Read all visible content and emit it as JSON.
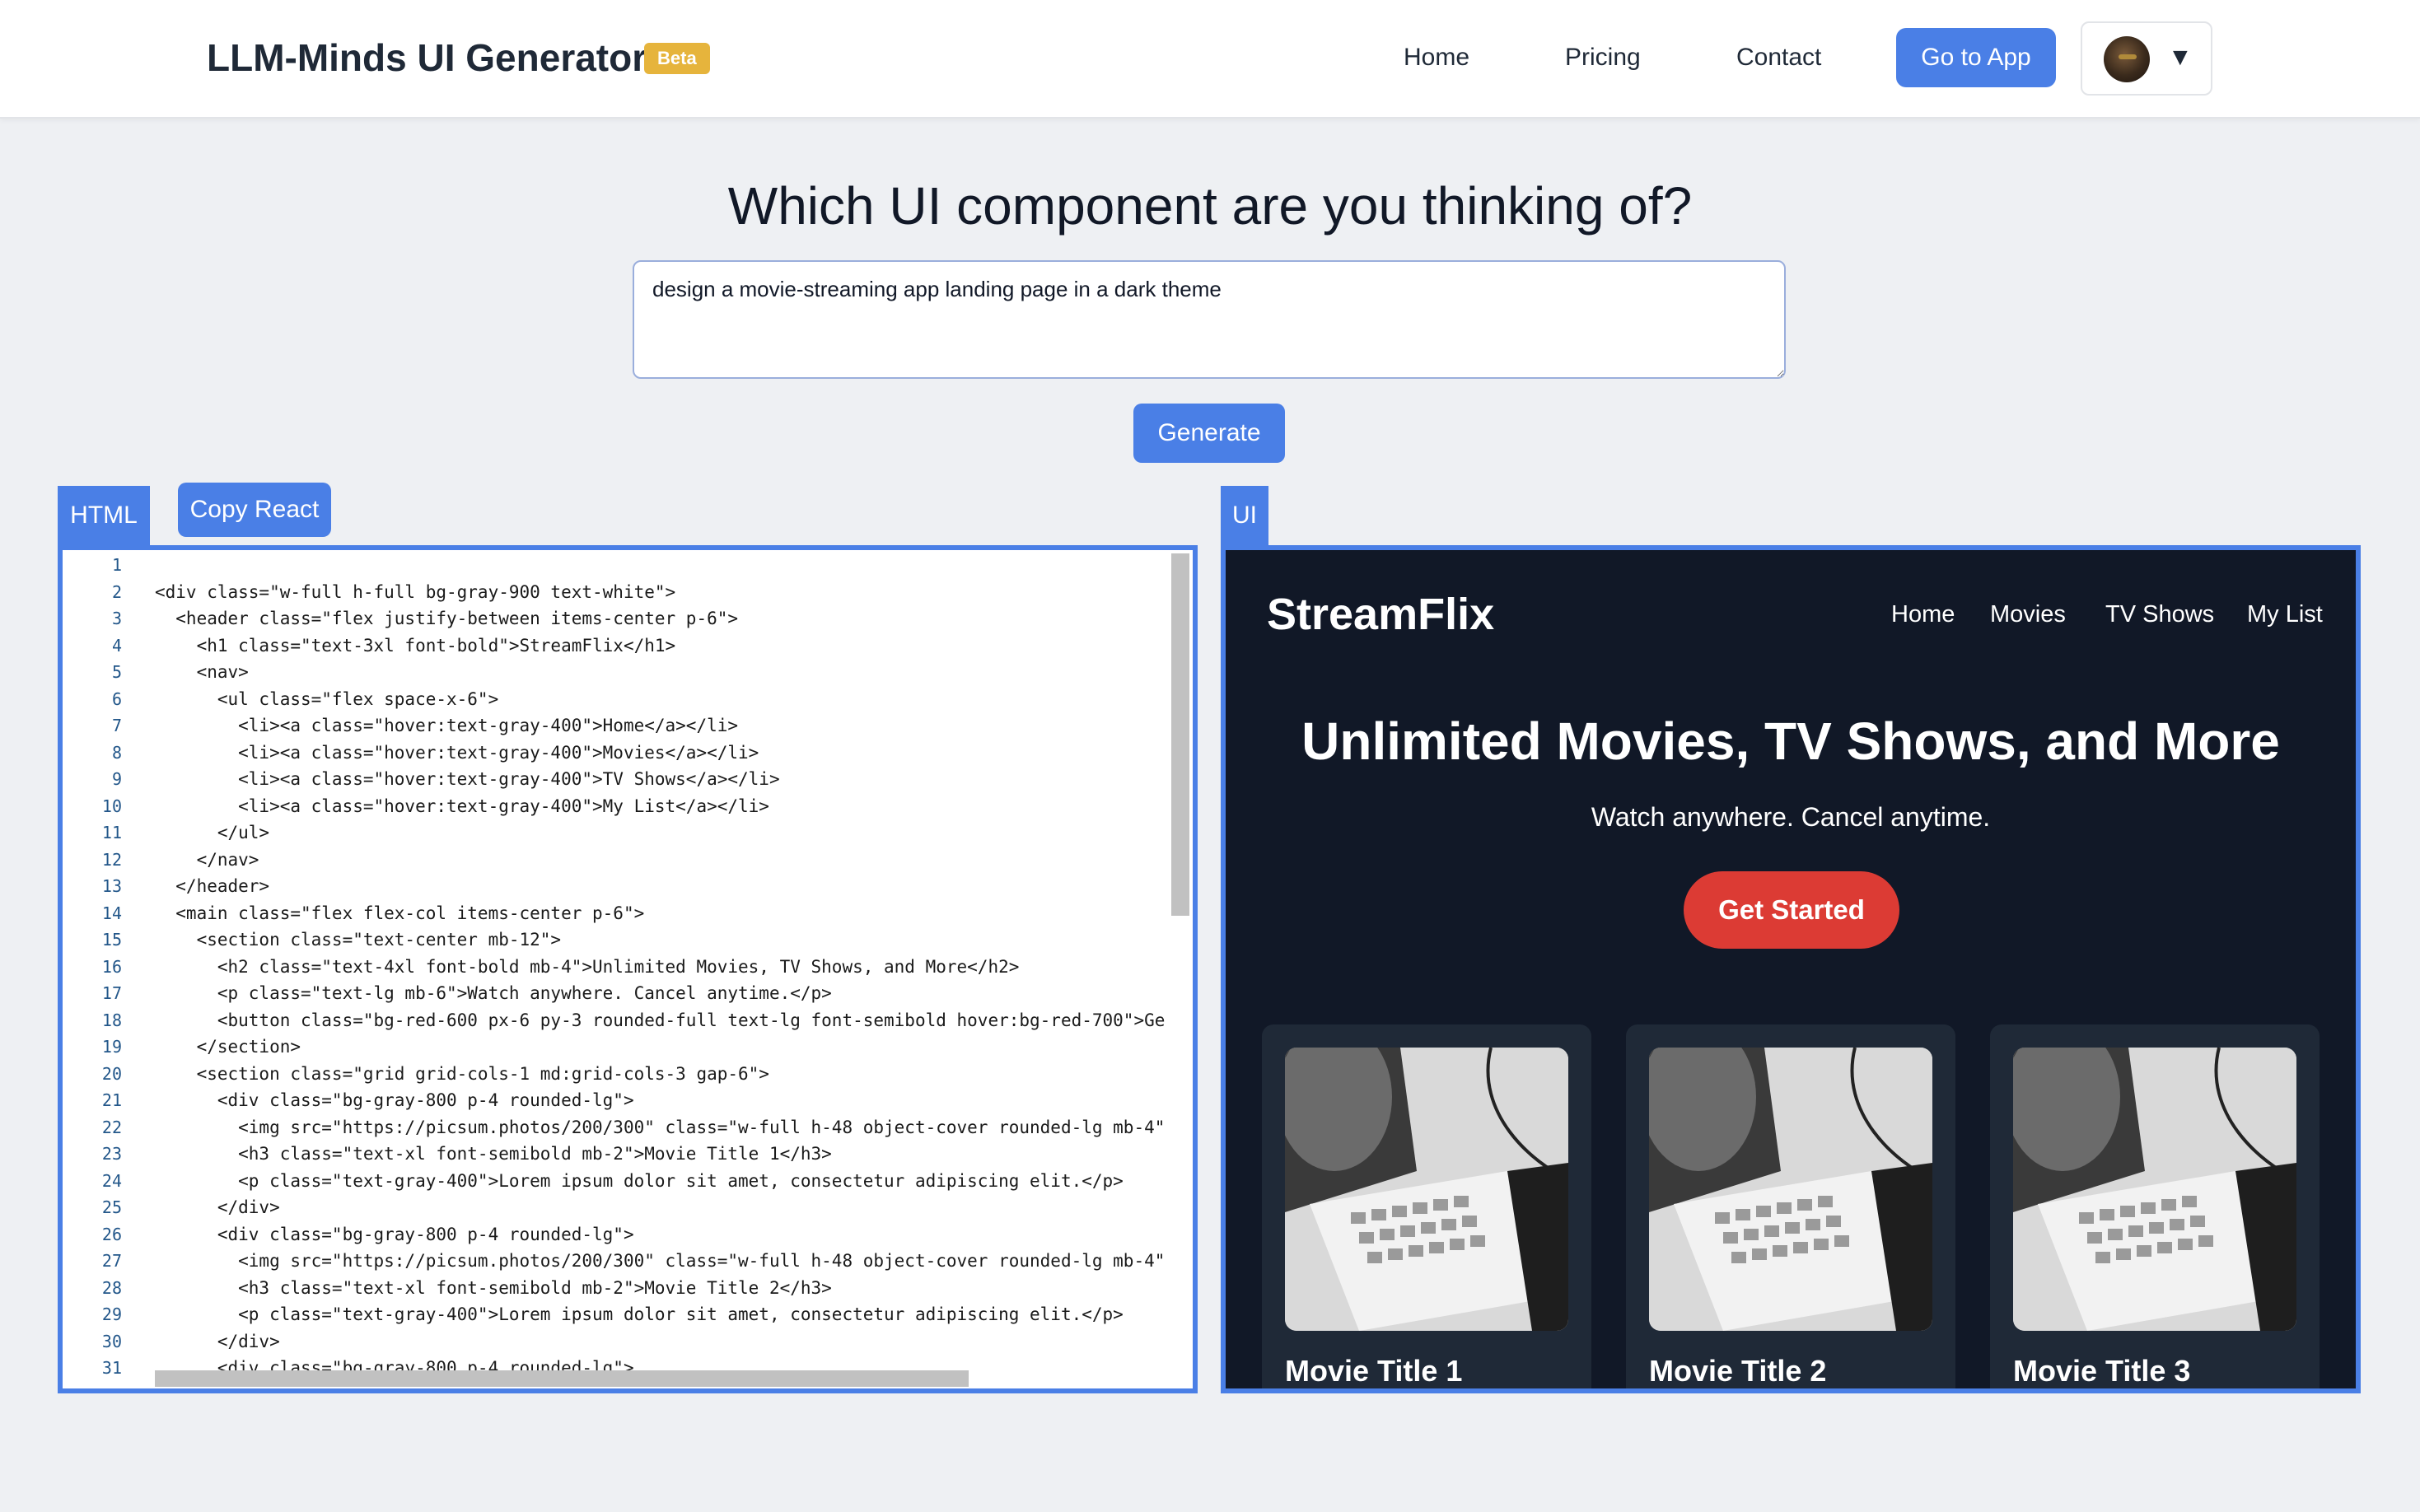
{
  "header": {
    "brand": "LLM-Minds UI Generator",
    "badge": "Beta",
    "nav": [
      "Home",
      "Pricing",
      "Contact"
    ],
    "cta": "Go to App",
    "menu_caret": "▼"
  },
  "hero": {
    "question": "Which UI component are you thinking of?",
    "prompt_value": "design a movie-streaming app landing page in a dark theme",
    "generate_label": "Generate"
  },
  "panels": {
    "html_tab": "HTML",
    "copy_react": "Copy React",
    "ui_tab": "UI"
  },
  "code_lines": [
    "",
    "<div class=\"w-full h-full bg-gray-900 text-white\">",
    "  <header class=\"flex justify-between items-center p-6\">",
    "    <h1 class=\"text-3xl font-bold\">StreamFlix</h1>",
    "    <nav>",
    "      <ul class=\"flex space-x-6\">",
    "        <li><a class=\"hover:text-gray-400\">Home</a></li>",
    "        <li><a class=\"hover:text-gray-400\">Movies</a></li>",
    "        <li><a class=\"hover:text-gray-400\">TV Shows</a></li>",
    "        <li><a class=\"hover:text-gray-400\">My List</a></li>",
    "      </ul>",
    "    </nav>",
    "  </header>",
    "  <main class=\"flex flex-col items-center p-6\">",
    "    <section class=\"text-center mb-12\">",
    "      <h2 class=\"text-4xl font-bold mb-4\">Unlimited Movies, TV Shows, and More</h2>",
    "      <p class=\"text-lg mb-6\">Watch anywhere. Cancel anytime.</p>",
    "      <button class=\"bg-red-600 px-6 py-3 rounded-full text-lg font-semibold hover:bg-red-700\">Ge",
    "    </section>",
    "    <section class=\"grid grid-cols-1 md:grid-cols-3 gap-6\">",
    "      <div class=\"bg-gray-800 p-4 rounded-lg\">",
    "        <img src=\"https://picsum.photos/200/300\" class=\"w-full h-48 object-cover rounded-lg mb-4\"",
    "        <h3 class=\"text-xl font-semibold mb-2\">Movie Title 1</h3>",
    "        <p class=\"text-gray-400\">Lorem ipsum dolor sit amet, consectetur adipiscing elit.</p>",
    "      </div>",
    "      <div class=\"bg-gray-800 p-4 rounded-lg\">",
    "        <img src=\"https://picsum.photos/200/300\" class=\"w-full h-48 object-cover rounded-lg mb-4\"",
    "        <h3 class=\"text-xl font-semibold mb-2\">Movie Title 2</h3>",
    "        <p class=\"text-gray-400\">Lorem ipsum dolor sit amet, consectetur adipiscing elit.</p>",
    "      </div>",
    "      <div class=\"bg-gray-800 p-4 rounded-lg\">"
  ],
  "preview": {
    "brand": "StreamFlix",
    "nav": [
      "Home",
      "Movies",
      "TV Shows",
      "My List"
    ],
    "headline": "Unlimited Movies, TV Shows, and More",
    "subline": "Watch anywhere. Cancel anytime.",
    "cta": "Get Started",
    "cards": [
      "Movie Title 1",
      "Movie Title 2",
      "Movie Title 3"
    ]
  },
  "colors": {
    "accent": "#4a7fe6",
    "badge": "#e6b43c",
    "preview_bg": "#111827",
    "card_bg": "#1f2937",
    "cta_red": "#dc3b34"
  }
}
